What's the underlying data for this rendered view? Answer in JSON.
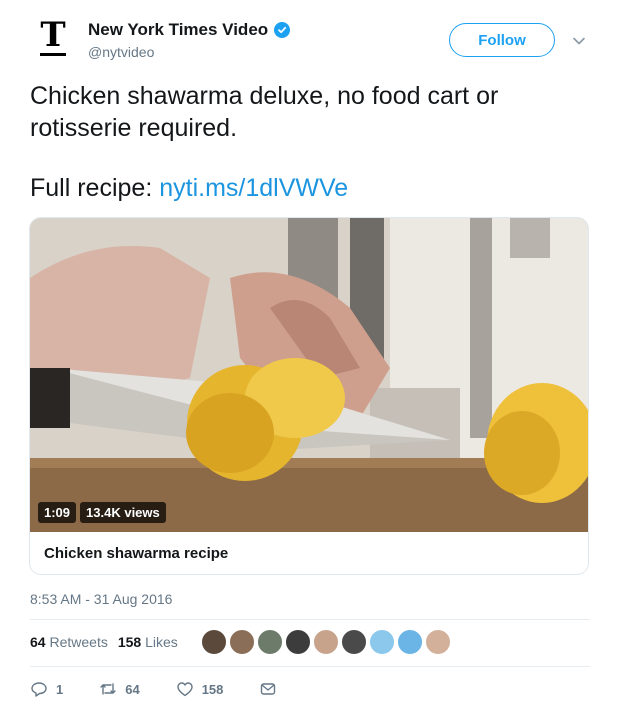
{
  "author": {
    "name": "New York Times Video",
    "handle": "@nytvideo",
    "logo_letter": "T",
    "verified": true
  },
  "follow_label": "Follow",
  "tweet": {
    "line1": "Chicken shawarma deluxe, no food cart or",
    "line2": "rotisserie required.",
    "recipe_prefix": "Full recipe: ",
    "recipe_link": "nyti.ms/1dlVWVe"
  },
  "card": {
    "duration": "1:09",
    "views": "13.4K views",
    "title": "Chicken shawarma recipe"
  },
  "timestamp": "8:53 AM - 31 Aug 2016",
  "stats": {
    "retweets_count": "64",
    "retweets_label": "Retweets",
    "likes_count": "158",
    "likes_label": "Likes"
  },
  "likers": [
    "#5b4a3c",
    "#8a6e58",
    "#6d7b6a",
    "#3c3c3c",
    "#c7a38c",
    "#4a4a4a",
    "#8cc7ec",
    "#6bb4e6",
    "#d2b09a"
  ],
  "actions": {
    "reply_count": "1",
    "retweet_count": "64",
    "like_count": "158"
  },
  "colors": {
    "accent": "#1da1f2",
    "link": "#1b95e0",
    "muted": "#657786"
  }
}
